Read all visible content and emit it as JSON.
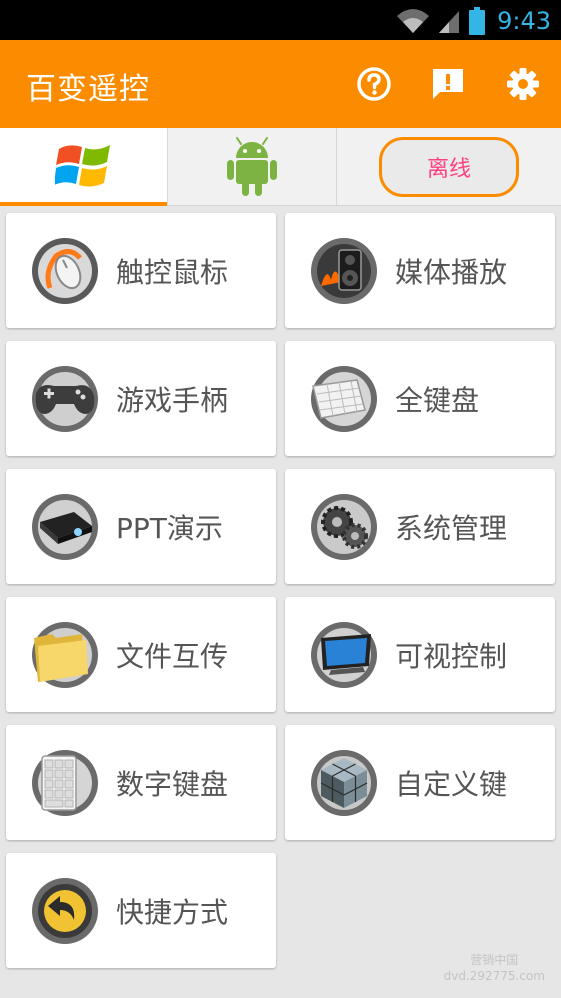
{
  "status_bar": {
    "time": "9:43",
    "icons": [
      "wifi-icon",
      "signal-icon",
      "battery-icon"
    ],
    "time_color": "#33b5e5"
  },
  "app_bar": {
    "title": "百变遥控",
    "background": "#fb8c00",
    "actions": [
      "help-icon",
      "feedback-icon",
      "settings-icon"
    ]
  },
  "tabs": {
    "items": [
      {
        "name": "windows",
        "icon": "windows-logo-icon",
        "selected": true
      },
      {
        "name": "android",
        "icon": "android-icon",
        "selected": false
      }
    ],
    "connection_status": "离线"
  },
  "features": [
    {
      "label": "触控鼠标",
      "icon": "mouse-icon"
    },
    {
      "label": "媒体播放",
      "icon": "media-speaker-icon"
    },
    {
      "label": "游戏手柄",
      "icon": "gamepad-icon"
    },
    {
      "label": "全键盘",
      "icon": "keyboard-icon"
    },
    {
      "label": "PPT演示",
      "icon": "projector-icon"
    },
    {
      "label": "系统管理",
      "icon": "gears-icon"
    },
    {
      "label": "文件互传",
      "icon": "folder-icon"
    },
    {
      "label": "可视控制",
      "icon": "monitor-icon"
    },
    {
      "label": "数字键盘",
      "icon": "numpad-icon"
    },
    {
      "label": "自定义键",
      "icon": "cube-icon"
    },
    {
      "label": "快捷方式",
      "icon": "shortcut-arrow-icon"
    }
  ],
  "watermark": {
    "line1": "营销中国",
    "line2": "dvd.292775.com"
  }
}
